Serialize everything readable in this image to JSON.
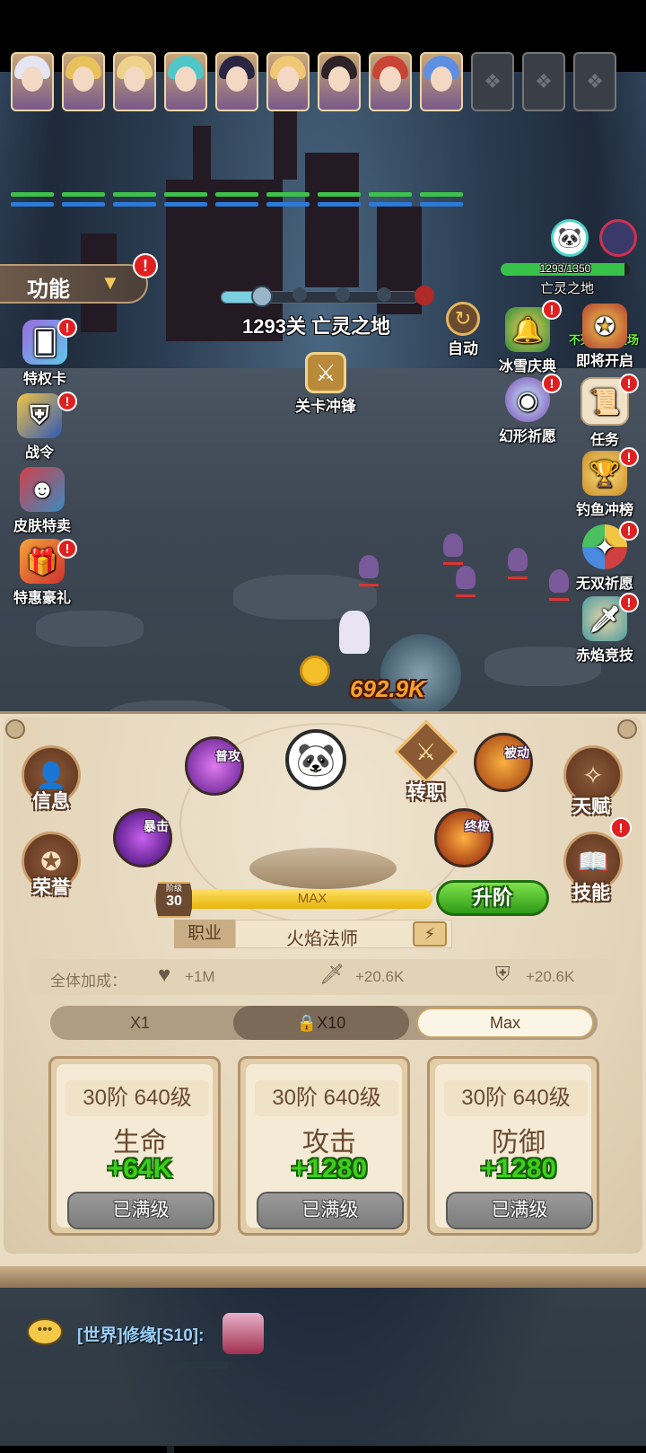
{
  "team": {
    "heroes": [
      {
        "hair": "#e6e6f2"
      },
      {
        "hair": "#e8c15a"
      },
      {
        "hair": "#efd28a"
      },
      {
        "hair": "#4fc7c9"
      },
      {
        "hair": "#2a2540"
      },
      {
        "hair": "#f0c875"
      },
      {
        "hair": "#2d2225"
      },
      {
        "hair": "#c84535"
      },
      {
        "hair": "#5e8fe0"
      }
    ],
    "locked_slots": 3
  },
  "boss": {
    "hp_text": "1293/1350",
    "name": "亡灵之地",
    "hp_fraction": 0.958
  },
  "function_menu": {
    "label": "功能"
  },
  "stage": {
    "title": "1293关 亡灵之地",
    "auto_label": "自动",
    "charge_label": "关卡冲锋"
  },
  "left_icons": [
    {
      "label": "特权卡",
      "icon": "card-icon"
    },
    {
      "label": "战令",
      "icon": "battle-pass-icon"
    },
    {
      "label": "皮肤特卖",
      "icon": "skin-icon"
    },
    {
      "label": "特惠豪礼",
      "icon": "gift-icon"
    }
  ],
  "right_icons": [
    {
      "label": "冰雪庆典",
      "icon": "bell-icon"
    },
    {
      "label": "即将开启",
      "icon": "arena-icon",
      "top_note": "不死鸟竞技场"
    },
    {
      "label": "幻形祈愿",
      "icon": "orb-icon"
    },
    {
      "label": "任务",
      "icon": "scroll-icon"
    },
    {
      "label": "钓鱼冲榜",
      "icon": "trophy-icon"
    },
    {
      "label": "无双祈愿",
      "icon": "wheel-icon"
    },
    {
      "label": "赤焰竞技",
      "icon": "sword-icon"
    }
  ],
  "damage_text": "692.9K",
  "panel": {
    "left_buttons": [
      {
        "label": "信息"
      },
      {
        "label": "荣誉"
      }
    ],
    "right_buttons": [
      {
        "label": "天赋"
      },
      {
        "label": "技能"
      }
    ],
    "skills": {
      "normal": "普攻",
      "passive": "被动",
      "crit": "暴击",
      "ultimate": "终极"
    },
    "transfer_label": "转职",
    "rank": {
      "caption": "阶级",
      "value": "30",
      "bar_text": "MAX",
      "bar_fraction": 1.0
    },
    "upgrade_label": "升阶",
    "job": {
      "label": "职业",
      "value": "火焰法师"
    },
    "bonus": {
      "label": "全体加成：",
      "hp": "+1M",
      "atk": "+20.6K",
      "def": "+20.6K"
    },
    "multipliers": [
      {
        "label": "X1"
      },
      {
        "label": "X10",
        "locked": true
      },
      {
        "label": "Max",
        "selected": true
      }
    ],
    "cards": [
      {
        "level": "30阶  640级",
        "name": "生命",
        "value": "+64K",
        "button": "已满级"
      },
      {
        "level": "30阶  640级",
        "name": "攻击",
        "value": "+1280",
        "button": "已满级"
      },
      {
        "level": "30阶  640级",
        "name": "防御",
        "value": "+1280",
        "button": "已满级"
      }
    ]
  },
  "chat": {
    "channel": "[世界]修缘[S10]:"
  }
}
